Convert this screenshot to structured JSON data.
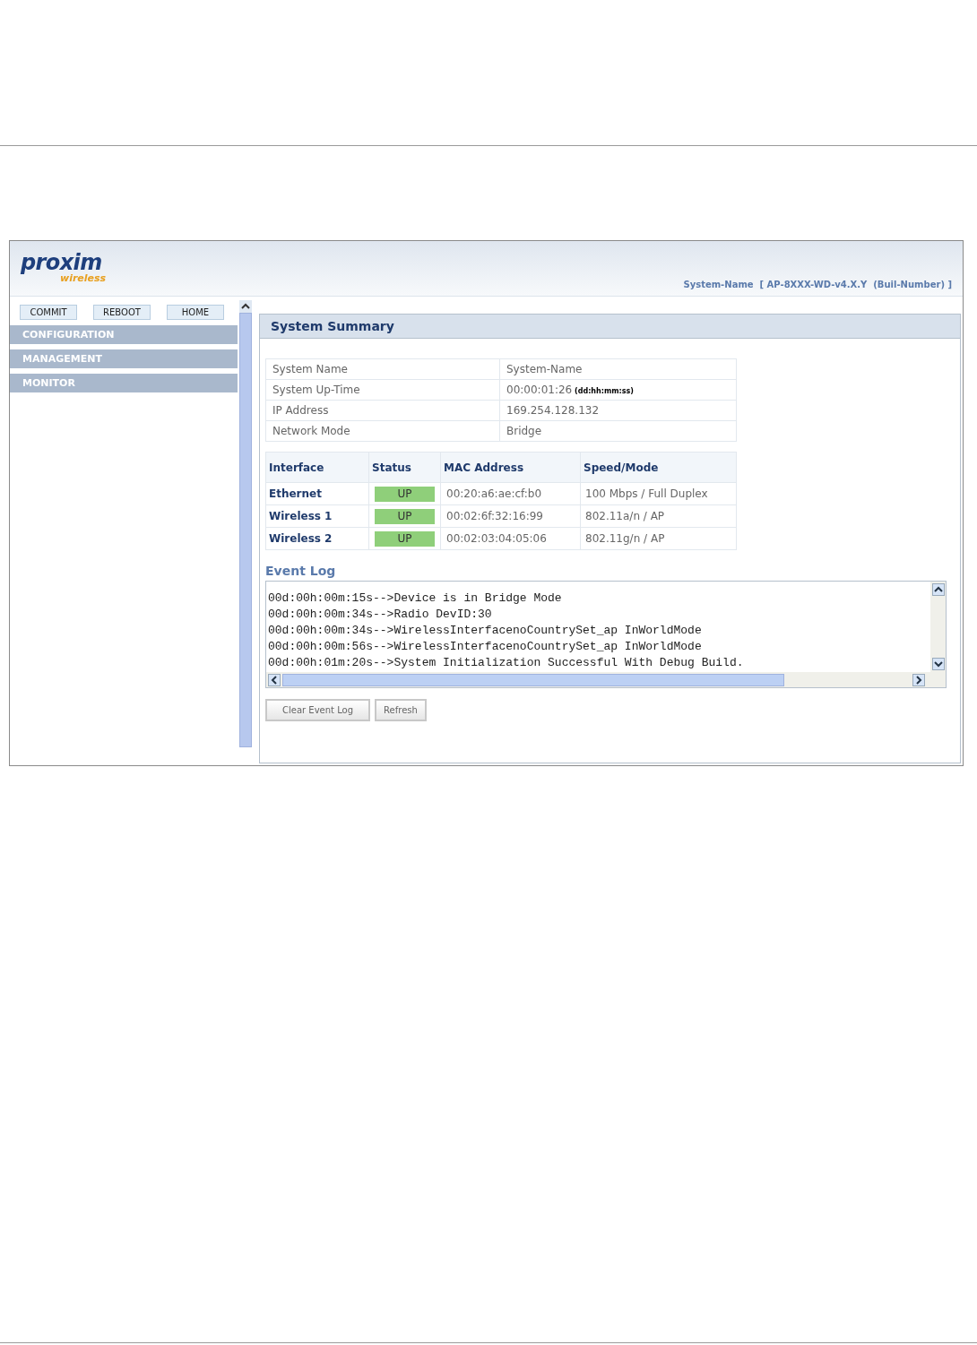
{
  "logo": {
    "name": "proxim",
    "tagline": "wireless"
  },
  "header": {
    "system_info": "System-Name  [ AP-8XXX-WD-v4.X.Y  (Buil-Number) ]"
  },
  "top_buttons": [
    "COMMIT",
    "REBOOT",
    "HOME"
  ],
  "menu": [
    {
      "label": "CONFIGURATION"
    },
    {
      "label": "MANAGEMENT"
    },
    {
      "label": "MONITOR"
    }
  ],
  "panel": {
    "title": "System Summary"
  },
  "summary": [
    {
      "label": "System Name",
      "value": "System-Name"
    },
    {
      "label": "System Up-Time",
      "value": "00:00:01:26",
      "hint": "(dd:hh:mm:ss)"
    },
    {
      "label": "IP Address",
      "value": "169.254.128.132"
    },
    {
      "label": "Network Mode",
      "value": "Bridge"
    }
  ],
  "interfaces": {
    "columns": [
      "Interface",
      "Status",
      "MAC Address",
      "Speed/Mode"
    ],
    "rows": [
      {
        "name": "Ethernet",
        "status": "UP",
        "color": "#8fcf7a",
        "mac": "00:20:a6:ae:cf:b0",
        "mode": "100 Mbps / Full Duplex"
      },
      {
        "name": "Wireless 1",
        "status": "UP",
        "color": "#8fcf7a",
        "mac": "00:02:6f:32:16:99",
        "mode": "802.11a/n / AP"
      },
      {
        "name": "Wireless 2",
        "status": "UP",
        "color": "#8fcf7a",
        "mac": "00:02:03:04:05:06",
        "mode": "802.11g/n / AP"
      }
    ]
  },
  "event_log": {
    "title": "Event Log",
    "lines": [
      "00d:00h:00m:15s-->Device is in Bridge Mode",
      "00d:00h:00m:34s-->Radio DevID:30",
      "00d:00h:00m:34s-->WirelessInterfacenoCountrySet_ap InWorldMode",
      "00d:00h:00m:56s-->WirelessInterfacenoCountrySet_ap InWorldMode",
      "00d:00h:01m:20s-->System Initialization Successful With Debug Build."
    ]
  },
  "log_buttons": [
    "Clear Event Log",
    "Refresh"
  ]
}
